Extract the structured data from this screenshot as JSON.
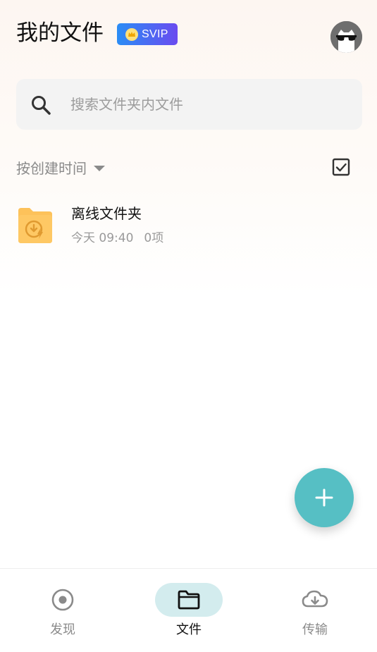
{
  "header": {
    "title": "我的文件",
    "badge": "SVIP",
    "avatar_icon": "cat-with-sunglasses-avatar"
  },
  "search": {
    "placeholder": "搜索文件夹内文件"
  },
  "sort": {
    "label": "按创建时间"
  },
  "files": [
    {
      "name": "离线文件夹",
      "date": "今天 09:40",
      "count": "0项",
      "icon": "offline-folder-icon"
    }
  ],
  "fab": {
    "icon": "plus-icon"
  },
  "bottom_nav": {
    "items": [
      {
        "label": "发现",
        "icon": "discover-icon",
        "active": false
      },
      {
        "label": "文件",
        "icon": "folder-icon",
        "active": true
      },
      {
        "label": "传输",
        "icon": "cloud-download-icon",
        "active": false
      }
    ]
  },
  "colors": {
    "accent": "#56bfc4",
    "badge_gradient_start": "#2a8df5",
    "badge_gradient_end": "#6a4bf0",
    "folder": "#fdc25a"
  }
}
